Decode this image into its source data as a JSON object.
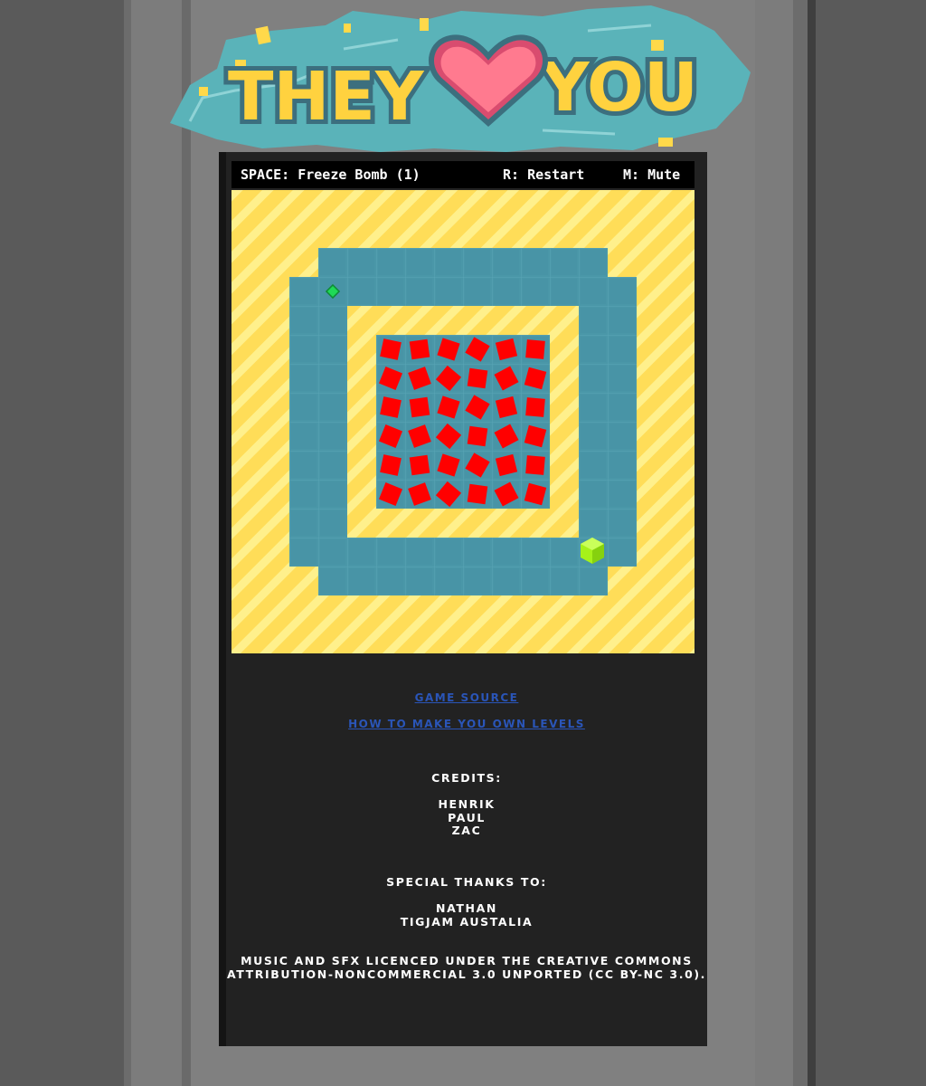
{
  "logo": {
    "word_left": "THEY",
    "word_right": "YOU",
    "heart_icon": "heart-icon"
  },
  "hud": {
    "freeze": "SPACE: Freeze Bomb (1)",
    "restart": "R: Restart",
    "mute": "M: Mute"
  },
  "game": {
    "player_icon": "green-cube",
    "pickup_icon": "green-gem",
    "enemy_icon": "red-diamond",
    "enemy_grid": {
      "rows": 6,
      "cols": 6
    },
    "colors": {
      "sand": "#ffdd58",
      "sand_stripe": "#fff08c",
      "water": "#4a97a8",
      "enemy": "#ff0000",
      "player": "#a6f21a"
    }
  },
  "links": {
    "source": "GAME SOURCE",
    "levels": "HOW TO MAKE YOU OWN LEVELS"
  },
  "credits": {
    "title": "CREDITS:",
    "names": [
      "HENRIK",
      "PAUL",
      "ZAC"
    ]
  },
  "thanks": {
    "title": "SPECIAL THANKS TO:",
    "names": [
      "NATHAN",
      "TIGJAM AUSTALIA"
    ]
  },
  "license": {
    "line1": "MUSIC AND SFX LICENCED UNDER THE CREATIVE COMMONS",
    "line2": "ATTRIBUTION-NONCOMMERCIAL 3.0 UNPORTED (CC BY-NC 3.0)."
  }
}
